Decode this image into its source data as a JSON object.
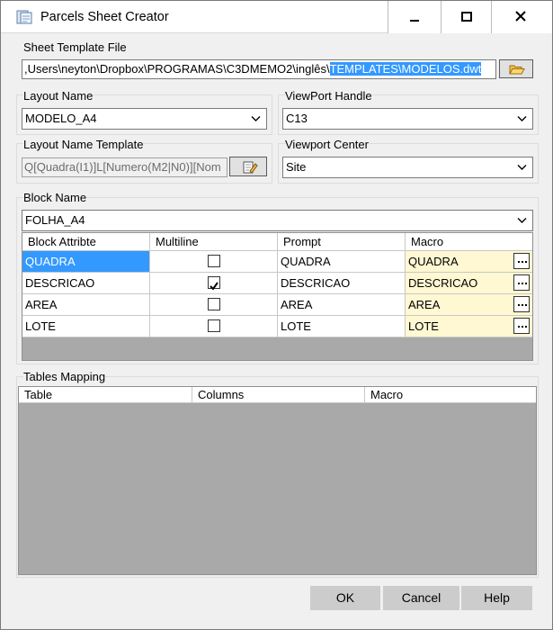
{
  "window": {
    "title": "Parcels Sheet Creator",
    "icon": "app-icon",
    "buttons": [
      "minimize-icon",
      "maximize-icon",
      "close-icon"
    ]
  },
  "sheet_template": {
    "label": "Sheet Template File",
    "path_prefix": ",Users\\neyton\\Dropbox\\PROGRAMAS\\C3DMEMO2\\inglês\\",
    "path_selected": "TEMPLATES\\MODELOS.dwt",
    "browse_icon": "folder-open-icon"
  },
  "layout_name": {
    "label": "Layout Name",
    "value": "MODELO_A4"
  },
  "viewport_handle": {
    "label": "ViewPort Handle",
    "value": "C13"
  },
  "layout_name_template": {
    "label": "Layout Name Template",
    "value": "Q[Quadra(I1)]L[Numero(M2|N0)][Nom",
    "edit_icon": "edit-icon"
  },
  "viewport_center": {
    "label": "Viewport Center",
    "value": "Site"
  },
  "block": {
    "label": "Block Name",
    "value": "FOLHA_A4",
    "columns": [
      "Block Attribte",
      "Multiline",
      "Prompt",
      "Macro"
    ],
    "rows": [
      {
        "attribute": "QUADRA",
        "multiline": false,
        "prompt": "QUADRA",
        "macro": "QUADRA"
      },
      {
        "attribute": "DESCRICAO",
        "multiline": true,
        "prompt": "DESCRICAO",
        "macro": "DESCRICAO"
      },
      {
        "attribute": "AREA",
        "multiline": false,
        "prompt": "AREA",
        "macro": "AREA"
      },
      {
        "attribute": "LOTE",
        "multiline": false,
        "prompt": "LOTE",
        "macro": "LOTE"
      }
    ]
  },
  "tables_mapping": {
    "label": "Tables Mapping",
    "columns": [
      "Table",
      "Columns",
      "Macro"
    ]
  },
  "buttons": {
    "ok": "OK",
    "cancel": "Cancel",
    "help": "Help"
  },
  "colors": {
    "selection": "#3399ff",
    "macro_cell": "#fff8d2",
    "grid_empty": "#a9a9a9"
  }
}
